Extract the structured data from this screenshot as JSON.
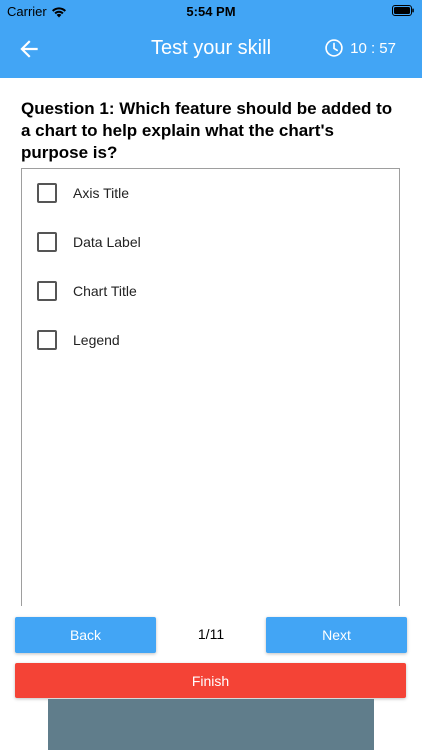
{
  "status_bar": {
    "carrier": "Carrier",
    "time": "5:54 PM"
  },
  "app_bar": {
    "title": "Test your skill",
    "timer": "10 : 57",
    "icons": [
      "back-arrow-icon",
      "clock-icon"
    ]
  },
  "question": {
    "text": "Question 1: Which feature should be added to a chart to help explain what the chart's purpose is?"
  },
  "options": [
    {
      "label": "Axis Title",
      "checked": false
    },
    {
      "label": "Data Label",
      "checked": false
    },
    {
      "label": "Chart Title",
      "checked": false
    },
    {
      "label": "Legend",
      "checked": false
    }
  ],
  "navigation": {
    "back_label": "Back",
    "next_label": "Next",
    "page_indicator": "1/11",
    "finish_label": "Finish"
  },
  "colors": {
    "primary": "#42a5f5",
    "finish": "#f44336",
    "bottom_panel": "#607d8b"
  }
}
